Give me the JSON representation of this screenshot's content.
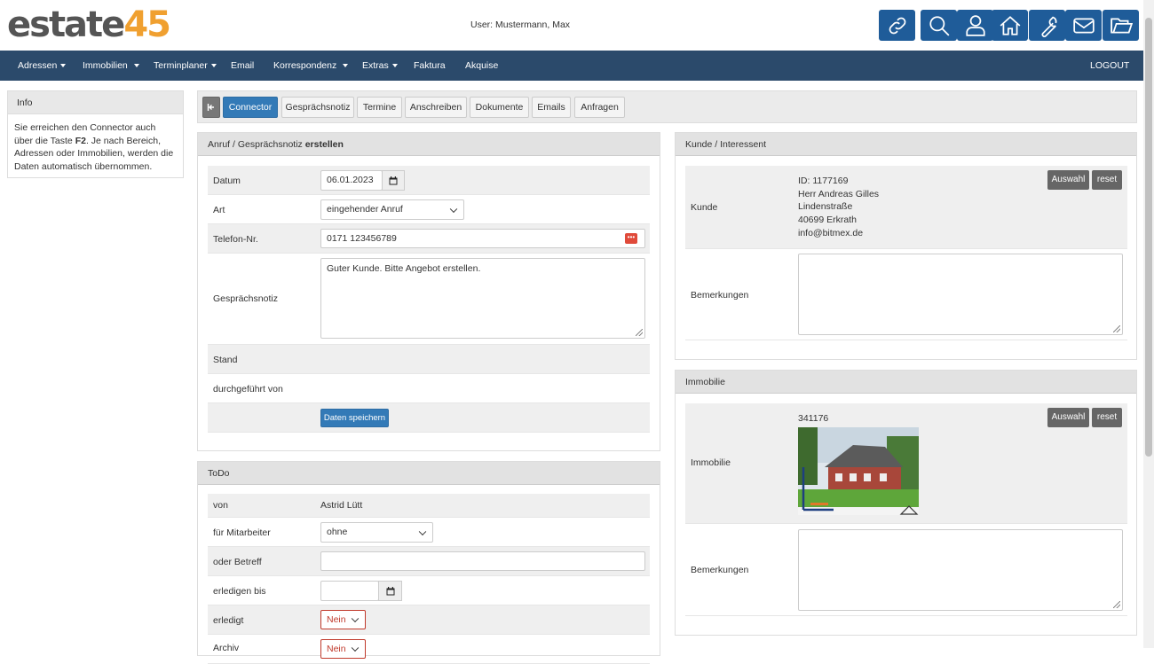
{
  "header": {
    "logo_part1": "estate",
    "logo_part2": "45",
    "user_text": "User: Mustermann, Max",
    "toolbar_icons": [
      "link-icon",
      "search-icon",
      "user-icon",
      "home-icon",
      "wrench-icon",
      "mail-icon",
      "folder-icon"
    ]
  },
  "nav": {
    "items": [
      "Adressen",
      "Immobilien",
      "Terminplaner",
      "Email",
      "Korrespondenz",
      "Extras",
      "Faktura",
      "Akquise"
    ],
    "logout": "LOGOUT"
  },
  "info": {
    "title": "Info",
    "text_pre": "Sie erreichen den Connector auch über die Taste ",
    "text_key": "F2",
    "text_post": ". Je nach Bereich, Adressen oder Immobilien, werden die Daten automatisch übernommen."
  },
  "tabs": [
    "Connector",
    "Gesprächsnotiz",
    "Termine",
    "Anschreiben",
    "Dokumente",
    "Emails",
    "Anfragen"
  ],
  "anruf": {
    "title_pre": "Anruf / Gesprächsnotiz ",
    "title_bold": "erstellen",
    "datum_label": "Datum",
    "datum_value": "06.01.2023",
    "art_label": "Art",
    "art_value": "eingehender Anruf",
    "telefon_label": "Telefon-Nr.",
    "telefon_value": "0171 123456789",
    "notiz_label": "Gesprächsnotiz",
    "notiz_value": "Guter Kunde. Bitte Angebot erstellen.",
    "stand_label": "Stand",
    "durch_label": "durchgeführt von",
    "save_label": "Daten speichern"
  },
  "todo": {
    "title": "ToDo",
    "von_label": "von",
    "von_value": "Astrid Lütt",
    "mitarbeiter_label": "für Mitarbeiter",
    "mitarbeiter_value": "ohne",
    "betreff_label": "oder Betreff",
    "bis_label": "erledigen bis",
    "erledigt_label": "erledigt",
    "erledigt_value": "Nein",
    "archiv_label": "Archiv",
    "archiv_value": "Nein"
  },
  "kunde": {
    "title": "Kunde / Interessent",
    "label": "Kunde",
    "id": "ID: 1177169",
    "name": "Herr Andreas Gilles",
    "street": "Lindenstraße",
    "city": "40699 Erkrath",
    "email": "info@bitmex.de",
    "auswahl": "Auswahl",
    "reset": "reset",
    "bemerkungen_label": "Bemerkungen"
  },
  "immobilie": {
    "title": "Immobilie",
    "label": "Immobilie",
    "id": "341176",
    "auswahl": "Auswahl",
    "reset": "reset",
    "bemerkungen_label": "Bemerkungen"
  }
}
